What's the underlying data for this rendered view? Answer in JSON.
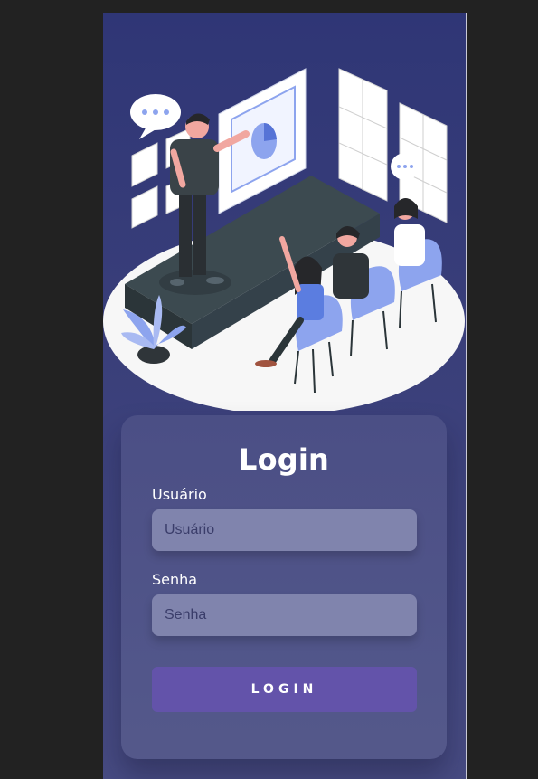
{
  "login": {
    "title": "Login",
    "username_label": "Usuário",
    "username_placeholder": "Usuário",
    "password_label": "Senha",
    "password_placeholder": "Senha",
    "button_label": "LOGIN"
  },
  "colors": {
    "background": "#222222",
    "panel_top": "#2f3676",
    "panel_bottom": "#474b82",
    "input_bg": "#8084ad",
    "button_bg": "#6353aa",
    "accent_blue": "#8da4ee"
  },
  "illustration": {
    "question_mark": "?"
  }
}
